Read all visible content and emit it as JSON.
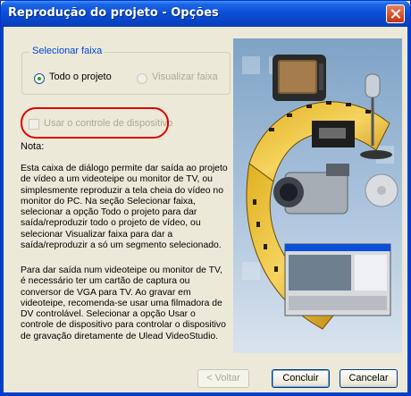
{
  "window": {
    "title": "Reprodução do projeto - Opções"
  },
  "select_track": {
    "legend": "Selecionar faixa",
    "options": [
      {
        "label": "Todo o projeto",
        "checked": true,
        "enabled": true
      },
      {
        "label": "Visualizar faixa",
        "checked": false,
        "enabled": false
      }
    ]
  },
  "device_control": {
    "label": "Usar o controle de dispositivo",
    "checked": false,
    "enabled": false
  },
  "note": {
    "heading": "Nota:",
    "paragraph1": "Esta caixa de diálogo permite dar saída ao projeto\nde vídeo a um videoteipe ou monitor de TV, ou\nsimplesmente reproduzir a tela cheia do vídeo no\nmonitor do PC. Na seção Selecionar faixa,\nselecionar a opção Todo o projeto para dar\nsaída/reproduzir todo o projeto de vídeo, ou\nselecionar Visualizar faixa para dar a\nsaída/reproduzir a só um segmento selecionado.",
    "paragraph2": "Para dar saída num videoteipe ou monitor de TV,\né necessário ter um cartão de captura ou\nconversor de VGA para TV. Ao gravar em\nvideoteipe, recomenda-se usar uma filmadora de\nDV controlável. Selecionar a opção Usar o\ncontrole de dispositivo para controlar o dispositivo\nde gravação diretamente de Ulead VideoStudio."
  },
  "buttons": {
    "back": "< Voltar",
    "finish": "Concluir",
    "cancel": "Cancelar"
  },
  "colors": {
    "titlebar": "#0a4fd6",
    "dialog_bg": "#ece9d8",
    "group_legend": "#0046d5",
    "highlight": "#e00000"
  }
}
